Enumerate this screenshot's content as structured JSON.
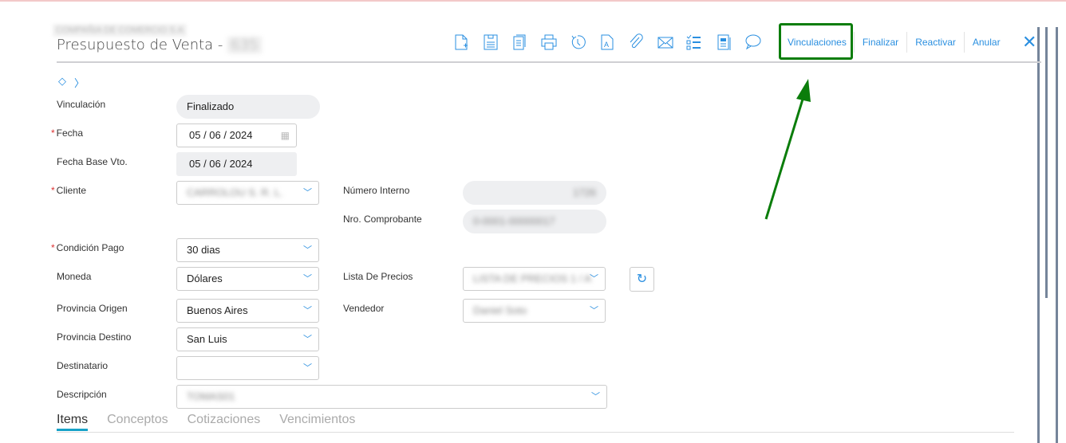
{
  "header": {
    "company": "COMPAÑIA DE COMERCIO S.A",
    "title": "Presupuesto de Venta -",
    "doc_number": "635"
  },
  "toolbar": {
    "icons": [
      "new-document-icon",
      "save-icon",
      "copy-icon",
      "print-icon",
      "history-icon",
      "text-document-icon",
      "attach-icon",
      "email-icon",
      "checklist-icon",
      "report-icon",
      "comment-icon"
    ],
    "actions": [
      "Vinculaciones",
      "Finalizar",
      "Reactivar",
      "Anular"
    ]
  },
  "form": {
    "vinculacion": {
      "label": "Vinculación",
      "value": "Finalizado"
    },
    "fecha": {
      "label": "Fecha",
      "value": "05 / 06 / 2024"
    },
    "fecha_base": {
      "label": "Fecha Base Vto.",
      "value": "05 / 06 / 2024"
    },
    "cliente": {
      "label": "Cliente",
      "value": "CARROLOU S. R. L."
    },
    "numero_interno": {
      "label": "Número Interno",
      "value": "1726"
    },
    "nro_comprobante": {
      "label": "Nro. Comprobante",
      "value": "0-0001-00000017"
    },
    "condicion_pago": {
      "label": "Condición Pago",
      "value": "30 dias"
    },
    "moneda": {
      "label": "Moneda",
      "value": "Dólares"
    },
    "lista_precios": {
      "label": "Lista De Precios",
      "value": "LISTA DE PRECIOS 1 / A"
    },
    "provincia_origen": {
      "label": "Provincia Origen",
      "value": "Buenos Aires"
    },
    "vendedor": {
      "label": "Vendedor",
      "value": "Daniel Soto"
    },
    "provincia_destino": {
      "label": "Provincia Destino",
      "value": "San Luis"
    },
    "destinatario": {
      "label": "Destinatario",
      "value": ""
    },
    "descripcion": {
      "label": "Descripción",
      "value": "TOMAS01"
    }
  },
  "tabs": [
    "Items",
    "Conceptos",
    "Cotizaciones",
    "Vencimientos"
  ],
  "colors": {
    "accent": "#2a8fe0",
    "highlight": "#0b7d0b"
  }
}
